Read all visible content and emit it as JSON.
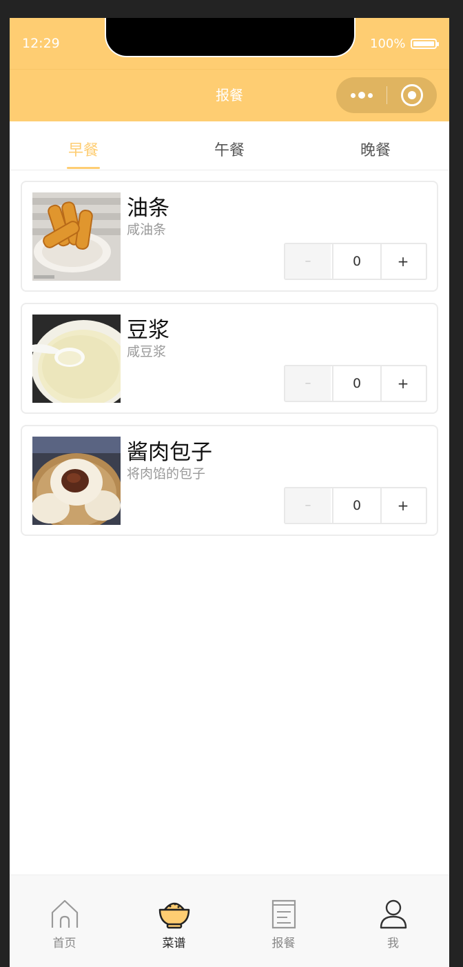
{
  "status_bar": {
    "time": "12:29",
    "battery": "100%"
  },
  "nav": {
    "title": "报餐"
  },
  "tabs": [
    {
      "label": "早餐",
      "active": true
    },
    {
      "label": "午餐",
      "active": false
    },
    {
      "label": "晚餐",
      "active": false
    }
  ],
  "items": [
    {
      "name": "油条",
      "desc": "咸油条",
      "qty": "0",
      "minus": "–",
      "plus": "+",
      "image": "youtiao-image"
    },
    {
      "name": "豆浆",
      "desc": "咸豆浆",
      "qty": "0",
      "minus": "–",
      "plus": "+",
      "image": "soy-milk-image"
    },
    {
      "name": "酱肉包子",
      "desc": "将肉馅的包子",
      "qty": "0",
      "minus": "–",
      "plus": "+",
      "image": "baozi-image"
    }
  ],
  "tabbar": [
    {
      "label": "首页",
      "icon": "home-icon",
      "active": false
    },
    {
      "label": "菜谱",
      "icon": "rice-bowl-icon",
      "active": true
    },
    {
      "label": "报餐",
      "icon": "document-icon",
      "active": false
    },
    {
      "label": "我",
      "icon": "user-icon",
      "active": false
    }
  ],
  "colors": {
    "accent": "#fecd72",
    "background": "#ffffff",
    "frame": "#232323"
  }
}
